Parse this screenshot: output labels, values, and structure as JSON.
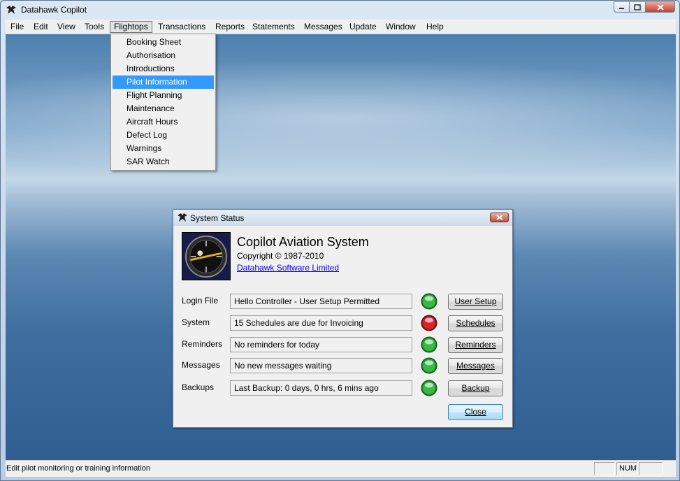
{
  "window": {
    "title": "Datahawk Copilot"
  },
  "menubar": {
    "items": [
      "File",
      "Edit",
      "View",
      "Tools",
      "Flightops",
      "Transactions",
      "Reports",
      "Statements",
      "Messages",
      "Update",
      "Window",
      "Help"
    ]
  },
  "flightops_menu": {
    "items": [
      "Booking Sheet",
      "Authorisation",
      "Introductions",
      "Pilot Information",
      "Flight Planning",
      "Maintenance",
      "Aircraft Hours",
      "Defect Log",
      "Warnings",
      "SAR Watch"
    ],
    "selected": "Pilot Information"
  },
  "dialog": {
    "title": "System Status",
    "app_name": "Copilot Aviation System",
    "copyright": "Copyright © 1987-2010",
    "company_link": "Datahawk Software Limited",
    "rows": [
      {
        "label": "Login File",
        "value": "Hello Controller - User Setup Permitted",
        "status": "green",
        "button": "User Setup"
      },
      {
        "label": "System",
        "value": "15 Schedules are due for Invoicing",
        "status": "red",
        "button": "Schedules"
      },
      {
        "label": "Reminders",
        "value": "No reminders for today",
        "status": "green",
        "button": "Reminders"
      },
      {
        "label": "Messages",
        "value": "No new messages waiting",
        "status": "green",
        "button": "Messages"
      },
      {
        "label": "Backups",
        "value": "Last Backup: 0 days,  0 hrs,  6 mins ago",
        "status": "green",
        "button": "Backup"
      }
    ],
    "close_label": "Close"
  },
  "statusbar": {
    "text": "Edit pilot monitoring or training information",
    "num_indicator": "NUM"
  },
  "colors": {
    "selection": "#3399ff",
    "status_green": "#2ea83a",
    "status_red": "#d8232a",
    "link": "#0000ee"
  },
  "icons": [
    "hawk-icon",
    "minimize-icon",
    "maximize-icon",
    "close-icon",
    "compass-logo"
  ]
}
